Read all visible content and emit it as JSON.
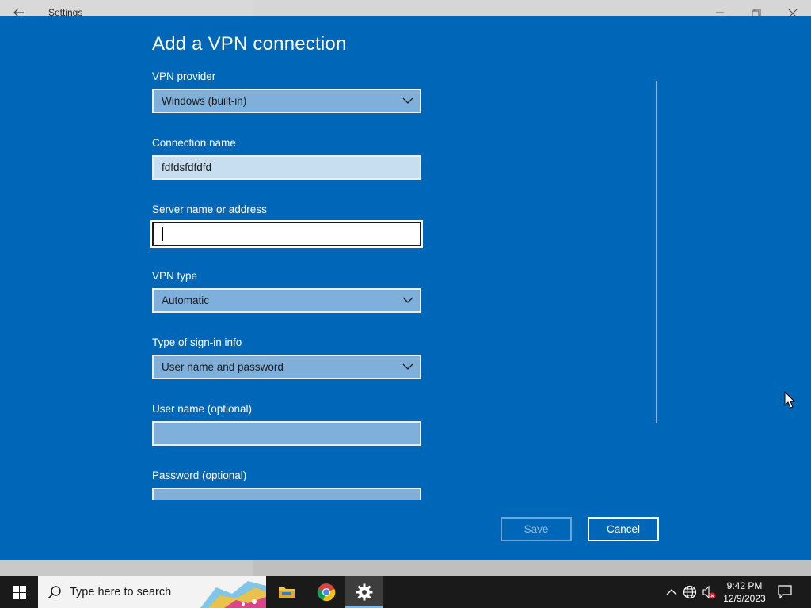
{
  "window": {
    "title": "Settings"
  },
  "dialog": {
    "heading": "Add a VPN connection",
    "fields": [
      {
        "label": "VPN provider",
        "type": "select",
        "value": "Windows (built-in)"
      },
      {
        "label": "Connection name",
        "type": "text",
        "value": "fdfdsfdfdfd"
      },
      {
        "label": "Server name or address",
        "type": "text",
        "value": ""
      },
      {
        "label": "VPN type",
        "type": "select",
        "value": "Automatic"
      },
      {
        "label": "Type of sign-in info",
        "type": "select",
        "value": "User name and password"
      },
      {
        "label": "User name (optional)",
        "type": "text",
        "value": ""
      },
      {
        "label": "Password (optional)",
        "type": "password",
        "value": ""
      }
    ],
    "save_label": "Save",
    "cancel_label": "Cancel"
  },
  "taskbar": {
    "search_placeholder": "Type here to search",
    "time": "9:42 PM",
    "date": "12/9/2023",
    "apps": [
      "file-explorer",
      "chrome",
      "settings"
    ]
  },
  "colors": {
    "dialog_bg": "#0067b8",
    "taskbar_bg": "#1a1a1a",
    "accent": "#76b9ed"
  }
}
